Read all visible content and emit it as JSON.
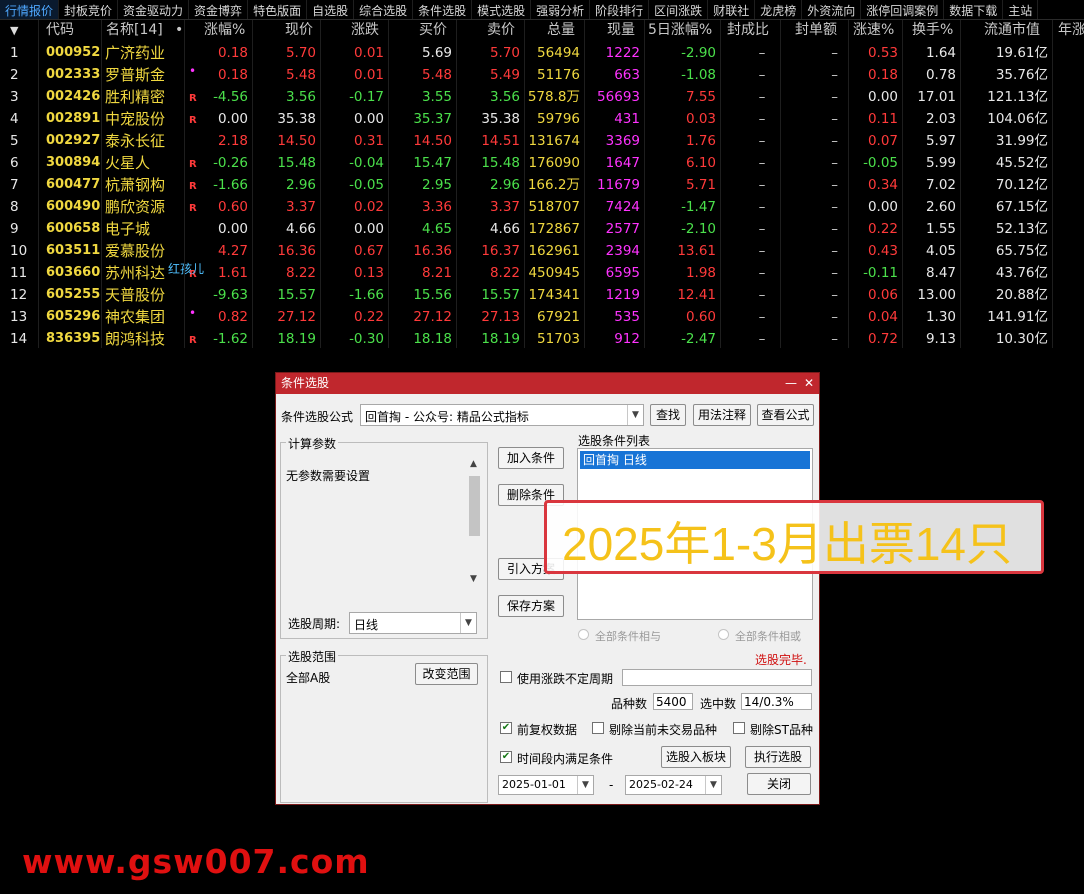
{
  "tabs": [
    "行情报价",
    "封板竞价",
    "资金驱动力",
    "资金博弈",
    "特色版面",
    "自选股",
    "综合选股",
    "条件选股",
    "模式选股",
    "强弱分析",
    "阶段排行",
    "区间涨跌",
    "财联社",
    "龙虎榜",
    "外资流向",
    "涨停回调案例",
    "数据下载",
    "主站"
  ],
  "columns": {
    "idx": "",
    "code": "代码",
    "name": "名称[14]",
    "dot": "•",
    "chg_pct": "涨幅%",
    "price": "现价",
    "chg": "涨跌",
    "bid": "买价",
    "ask": "卖价",
    "volume": "总量",
    "cur_vol": "现量",
    "chg5": "5日涨幅%",
    "seal_ratio": "封成比",
    "seal_amt": "封单额",
    "speed": "涨速%",
    "turnover": "换手%",
    "float_cap": "流通市值",
    "year": "年涨"
  },
  "rows": [
    {
      "idx": "1",
      "code": "000952",
      "name": "广济药业",
      "tag": "",
      "chg_pct": "0.18",
      "price": "5.70",
      "chg": "0.01",
      "bid": "5.69",
      "ask": "5.70",
      "volume": "56494",
      "cur_vol": "1222",
      "chg5": "-2.90",
      "seal_ratio": "–",
      "seal_amt": "–",
      "speed": "0.53",
      "turnover": "1.64",
      "float_cap": "19.61亿"
    },
    {
      "idx": "2",
      "code": "002333",
      "name": "罗普斯金",
      "tag": "•",
      "chg_pct": "0.18",
      "price": "5.48",
      "chg": "0.01",
      "bid": "5.48",
      "ask": "5.49",
      "volume": "51176",
      "cur_vol": "663",
      "chg5": "-1.08",
      "seal_ratio": "–",
      "seal_amt": "–",
      "speed": "0.18",
      "turnover": "0.78",
      "float_cap": "35.76亿"
    },
    {
      "idx": "3",
      "code": "002426",
      "name": "胜利精密",
      "tag": "R",
      "chg_pct": "-4.56",
      "price": "3.56",
      "chg": "-0.17",
      "bid": "3.55",
      "ask": "3.56",
      "volume": "578.8万",
      "cur_vol": "56693",
      "chg5": "7.55",
      "seal_ratio": "–",
      "seal_amt": "–",
      "speed": "0.00",
      "turnover": "17.01",
      "float_cap": "121.13亿"
    },
    {
      "idx": "4",
      "code": "002891",
      "name": "中宠股份",
      "tag": "R",
      "chg_pct": "0.00",
      "price": "35.38",
      "chg": "0.00",
      "bid": "35.37",
      "ask": "35.38",
      "volume": "59796",
      "cur_vol": "431",
      "chg5": "0.03",
      "seal_ratio": "–",
      "seal_amt": "–",
      "speed": "0.11",
      "turnover": "2.03",
      "float_cap": "104.06亿"
    },
    {
      "idx": "5",
      "code": "002927",
      "name": "泰永长征",
      "tag": "",
      "chg_pct": "2.18",
      "price": "14.50",
      "chg": "0.31",
      "bid": "14.50",
      "ask": "14.51",
      "volume": "131674",
      "cur_vol": "3369",
      "chg5": "1.76",
      "seal_ratio": "–",
      "seal_amt": "–",
      "speed": "0.07",
      "turnover": "5.97",
      "float_cap": "31.99亿"
    },
    {
      "idx": "6",
      "code": "300894",
      "name": "火星人",
      "tag": "R",
      "chg_pct": "-0.26",
      "price": "15.48",
      "chg": "-0.04",
      "bid": "15.47",
      "ask": "15.48",
      "volume": "176090",
      "cur_vol": "1647",
      "chg5": "6.10",
      "seal_ratio": "–",
      "seal_amt": "–",
      "speed": "-0.05",
      "turnover": "5.99",
      "float_cap": "45.52亿"
    },
    {
      "idx": "7",
      "code": "600477",
      "name": "杭萧钢构",
      "tag": "R",
      "chg_pct": "-1.66",
      "price": "2.96",
      "chg": "-0.05",
      "bid": "2.95",
      "ask": "2.96",
      "volume": "166.2万",
      "cur_vol": "11679",
      "chg5": "5.71",
      "seal_ratio": "–",
      "seal_amt": "–",
      "speed": "0.34",
      "turnover": "7.02",
      "float_cap": "70.12亿"
    },
    {
      "idx": "8",
      "code": "600490",
      "name": "鹏欣资源",
      "tag": "R",
      "chg_pct": "0.60",
      "price": "3.37",
      "chg": "0.02",
      "bid": "3.36",
      "ask": "3.37",
      "volume": "518707",
      "cur_vol": "7424",
      "chg5": "-1.47",
      "seal_ratio": "–",
      "seal_amt": "–",
      "speed": "0.00",
      "turnover": "2.60",
      "float_cap": "67.15亿"
    },
    {
      "idx": "9",
      "code": "600658",
      "name": "电子城",
      "tag": "",
      "chg_pct": "0.00",
      "price": "4.66",
      "chg": "0.00",
      "bid": "4.65",
      "ask": "4.66",
      "volume": "172867",
      "cur_vol": "2577",
      "chg5": "-2.10",
      "seal_ratio": "–",
      "seal_amt": "–",
      "speed": "0.22",
      "turnover": "1.55",
      "float_cap": "52.13亿"
    },
    {
      "idx": "10",
      "code": "603511",
      "name": "爱慕股份",
      "tag": "",
      "chg_pct": "4.27",
      "price": "16.36",
      "chg": "0.67",
      "bid": "16.36",
      "ask": "16.37",
      "volume": "162961",
      "cur_vol": "2394",
      "chg5": "13.61",
      "seal_ratio": "–",
      "seal_amt": "–",
      "speed": "0.43",
      "turnover": "4.05",
      "float_cap": "65.75亿"
    },
    {
      "idx": "11",
      "code": "603660",
      "name": "苏州科达",
      "tag": "R",
      "chg_pct": "1.61",
      "price": "8.22",
      "chg": "0.13",
      "bid": "8.21",
      "ask": "8.22",
      "volume": "450945",
      "cur_vol": "6595",
      "chg5": "1.98",
      "seal_ratio": "–",
      "seal_amt": "–",
      "speed": "-0.11",
      "turnover": "8.47",
      "float_cap": "43.76亿"
    },
    {
      "idx": "12",
      "code": "605255",
      "name": "天普股份",
      "tag": "",
      "chg_pct": "-9.63",
      "price": "15.57",
      "chg": "-1.66",
      "bid": "15.56",
      "ask": "15.57",
      "volume": "174341",
      "cur_vol": "1219",
      "chg5": "12.41",
      "seal_ratio": "–",
      "seal_amt": "–",
      "speed": "0.06",
      "turnover": "13.00",
      "float_cap": "20.88亿"
    },
    {
      "idx": "13",
      "code": "605296",
      "name": "神农集团",
      "tag": "•",
      "chg_pct": "0.82",
      "price": "27.12",
      "chg": "0.22",
      "bid": "27.12",
      "ask": "27.13",
      "volume": "67921",
      "cur_vol": "535",
      "chg5": "0.60",
      "seal_ratio": "–",
      "seal_amt": "–",
      "speed": "0.04",
      "turnover": "1.30",
      "float_cap": "141.91亿"
    },
    {
      "idx": "14",
      "code": "836395",
      "name": "朗鸿科技",
      "tag": "R",
      "chg_pct": "-1.62",
      "price": "18.19",
      "chg": "-0.30",
      "bid": "18.18",
      "ask": "18.19",
      "volume": "51703",
      "cur_vol": "912",
      "chg5": "-2.47",
      "seal_ratio": "–",
      "seal_amt": "–",
      "speed": "0.72",
      "turnover": "9.13",
      "float_cap": "10.30亿"
    }
  ],
  "red_child_label": "红孩儿",
  "dialog": {
    "title": "条件选股",
    "min_btn": "—",
    "close_btn": "✕",
    "formula_label": "条件选股公式",
    "formula_value": "回首掏  -  公众号: 精品公式指标",
    "find_btn": "查找",
    "usage_btn": "用法注释",
    "view_btn": "查看公式",
    "calc_params_title": "计算参数",
    "no_params_text": "无参数需要设置",
    "add_cond_btn": "加入条件",
    "del_cond_btn": "删除条件",
    "import_btn": "引入方案",
    "save_btn": "保存方案",
    "cond_list_title": "选股条件列表",
    "cond_list_items": [
      "回首掏  日线"
    ],
    "period_label": "选股周期:",
    "period_value": "日线",
    "radio_and": "全部条件相与",
    "radio_or": "全部条件相或",
    "status": "选股完毕.",
    "range_title": "选股范围",
    "range_value": "全部A股",
    "change_range_btn": "改变范围",
    "use_period_label": "使用涨跌不定周期",
    "count_label": "品种数",
    "count_value": "5400",
    "selected_label": "选中数",
    "selected_value": "14/0.3%",
    "fq_label": "前复权数据",
    "remove_untraded_label": "剔除当前未交易品种",
    "remove_st_label": "剔除ST品种",
    "time_cond_label": "时间段内满足条件",
    "to_block_btn": "选股入板块",
    "exec_btn": "执行选股",
    "date_from": "2025-01-01",
    "date_sep": "-",
    "date_to": "2025-02-24",
    "close_dialog_btn": "关闭"
  },
  "promo_text": "2025年1-3月出票14只",
  "watermark": "www.gsw007.com",
  "colors": {
    "up": "#ff3a3a",
    "down": "#4be04b",
    "code": "#f0d840",
    "current_vol": "#ff33ff",
    "title_bar": "#c0272d"
  }
}
